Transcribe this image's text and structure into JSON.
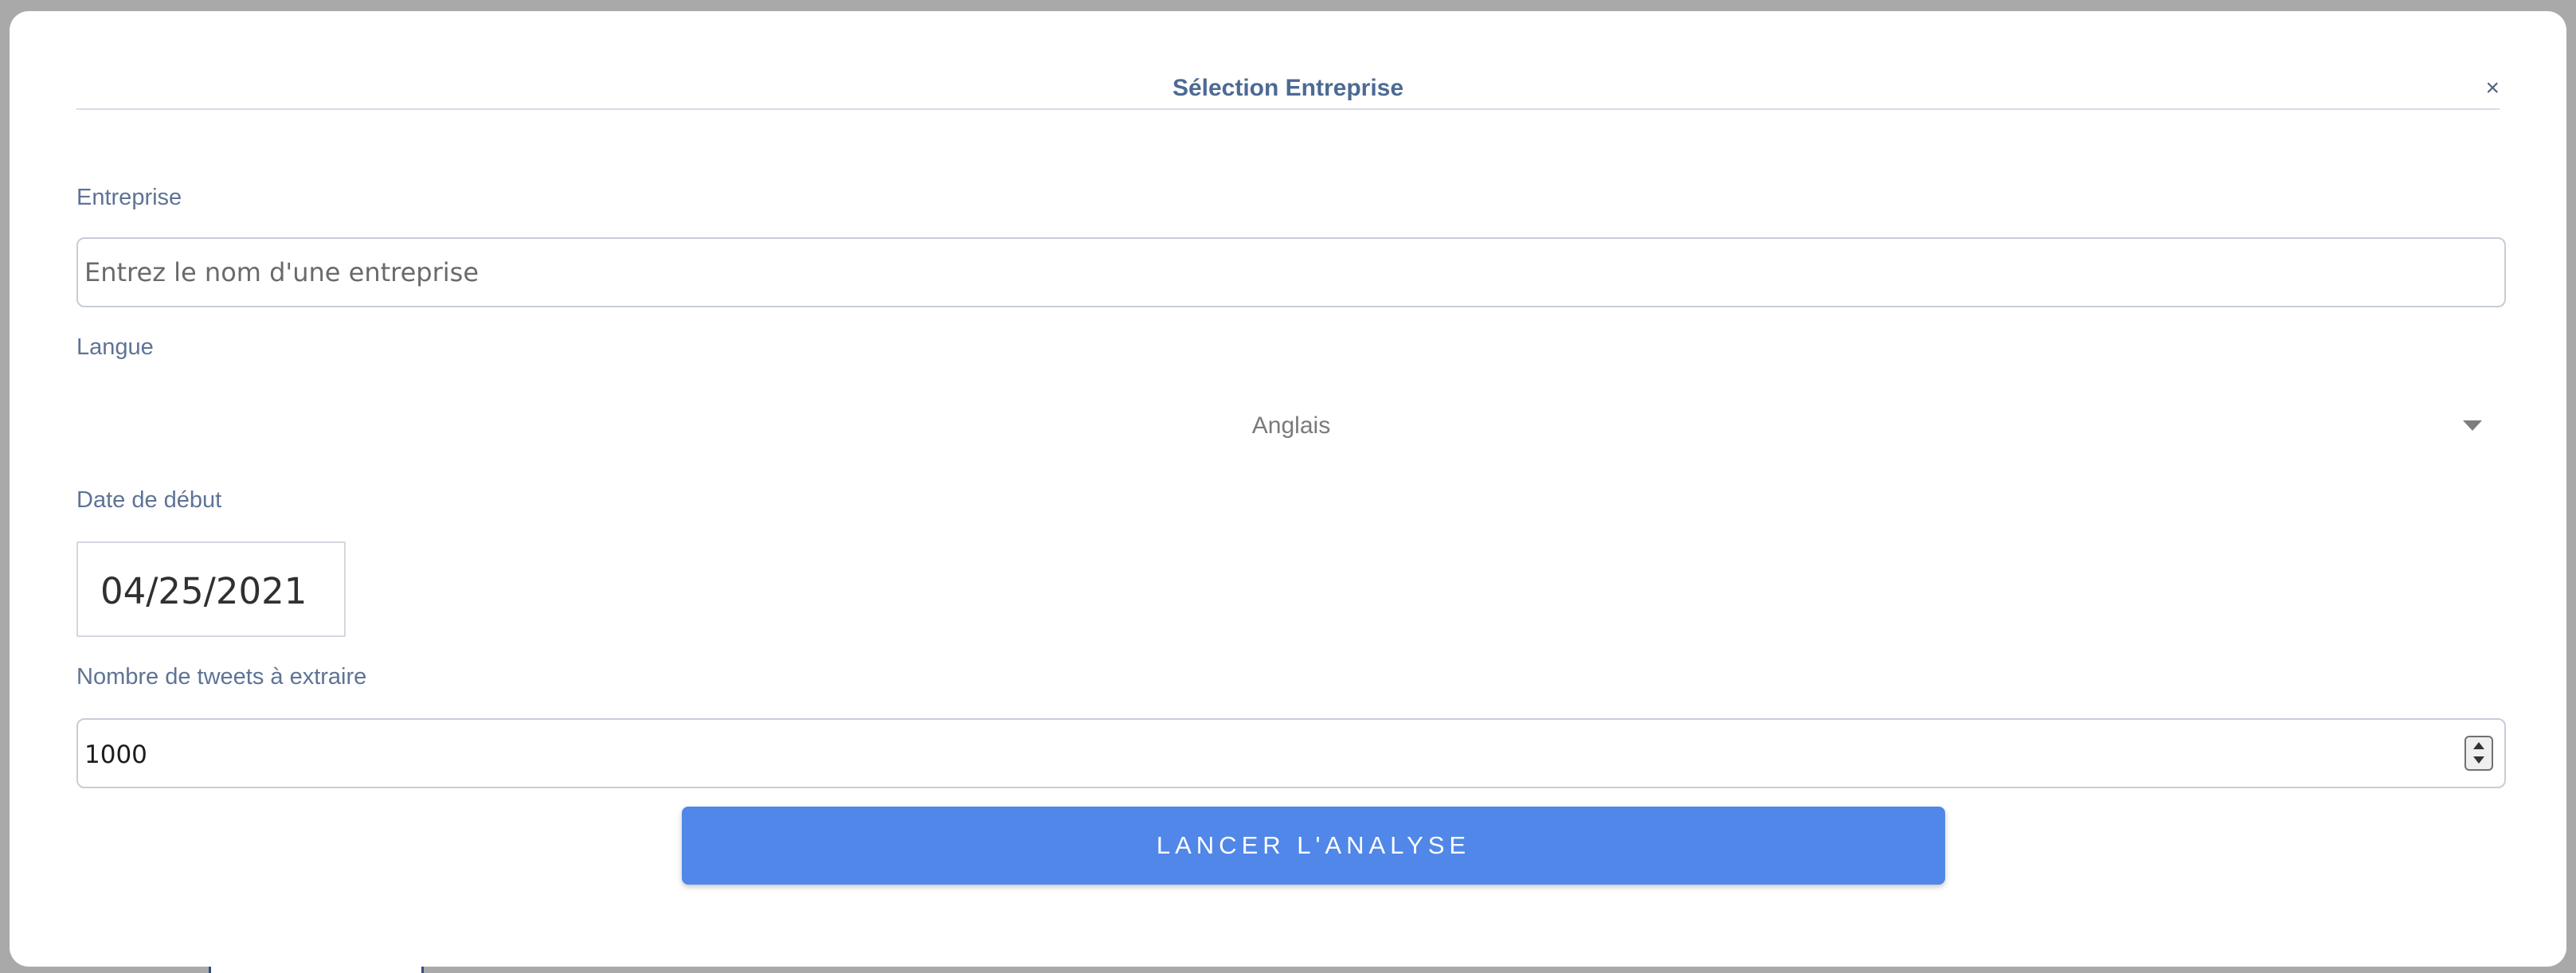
{
  "modal": {
    "title": "Sélection Entreprise",
    "close_label": "×"
  },
  "form": {
    "company": {
      "label": "Entreprise",
      "placeholder": "Entrez le nom d'une entreprise",
      "value": ""
    },
    "language": {
      "label": "Langue",
      "selected": "Anglais"
    },
    "start_date": {
      "label": "Date de début",
      "value": "04/25/2021"
    },
    "tweet_count": {
      "label": "Nombre de tweets à extraire",
      "value": "1000"
    },
    "submit_label": "LANCER L'ANALYSE"
  },
  "colors": {
    "accent": "#5087e8",
    "label": "#5e7395",
    "title": "#4c6a94"
  },
  "icons": {
    "close": "close-icon",
    "dropdown": "chevron-down-icon",
    "spinner": "spinner-icon"
  }
}
